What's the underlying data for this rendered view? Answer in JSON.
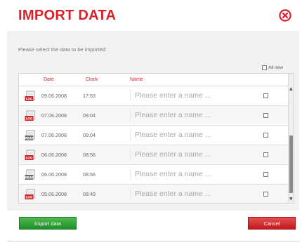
{
  "dialog": {
    "title": "IMPORT DATA",
    "prompt": "Please select the data to be imported:",
    "all_new_label": "All new",
    "columns": {
      "date": "Date",
      "clock": "Clock",
      "name": "Name"
    },
    "name_placeholder": "Please enter a name ...",
    "rows": [
      {
        "type": "LOG",
        "icon_color": "#c9262b",
        "date": "09.06.2008",
        "clock": "17:53"
      },
      {
        "type": "LOG",
        "icon_color": "#c9262b",
        "date": "07.06.2008",
        "clock": "09:04"
      },
      {
        "type": "MEAS",
        "icon_color": "#6d6d6d",
        "date": "07.06.2008",
        "clock": "09:04"
      },
      {
        "type": "LOG",
        "icon_color": "#c9262b",
        "date": "06.06.2008",
        "clock": "08:56"
      },
      {
        "type": "MEAS",
        "icon_color": "#6d6d6d",
        "date": "06.06.2008",
        "clock": "08:56"
      },
      {
        "type": "LOG",
        "icon_color": "#c9262b",
        "date": "05.06.2008",
        "clock": "08:49"
      }
    ],
    "buttons": {
      "import": "Import data",
      "cancel": "Cancel"
    },
    "colors": {
      "accent": "#d8212d",
      "import_green": "#2a9a35",
      "cancel_red": "#d42a2e"
    }
  }
}
